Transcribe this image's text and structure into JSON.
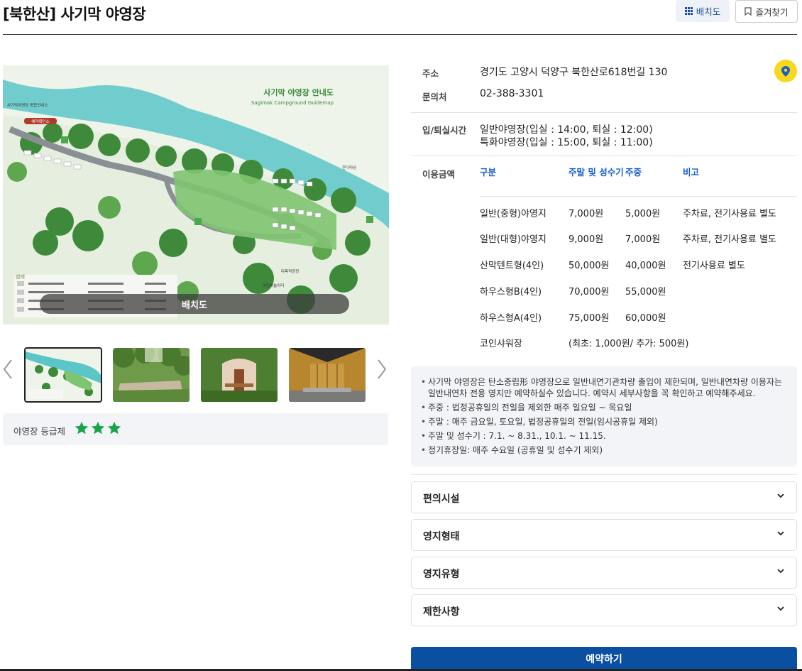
{
  "header": {
    "title": "[북한산] 사기막 야영장",
    "map_button": "배치도",
    "favorite_button": "즐겨찾기"
  },
  "gallery": {
    "map_title_ko": "사기막 야영장 안내도",
    "map_title_en": "Sagimak Campground Guidemap",
    "map_caption": "배치도",
    "map_labels": [
      "사기막야영장 종합안내소",
      "예약확인소",
      "잔디마당",
      "다목적광장",
      "어린이놀이터",
      "범례"
    ],
    "thumbnails": [
      {
        "name": "map",
        "selected": true
      },
      {
        "name": "gravel-site",
        "selected": false
      },
      {
        "name": "tent-cabin",
        "selected": false
      },
      {
        "name": "tent-interior",
        "selected": false
      }
    ]
  },
  "grade": {
    "label": "야영장 등급제",
    "stars": 3
  },
  "info": {
    "address_label": "주소",
    "address": "경기도 고양시 덕양구 북한산로618번길 130",
    "contact_label": "문의처",
    "contact": "02-388-3301",
    "time_label": "입/퇴실시간",
    "time_lines": [
      "일반야영장(입실 : 14:00, 퇴실 : 12:00)",
      "특화야영장(입실 : 15:00, 퇴실 : 11:00)"
    ],
    "fee_label": "이용금액",
    "fee_headers": [
      "구분",
      "주말 및 성수기",
      "주중",
      "비고"
    ],
    "fee_rows": [
      [
        "일반(중형)야영지",
        "7,000원",
        "5,000원",
        "주차료, 전기사용료 별도"
      ],
      [
        "일반(대형)야영지",
        "9,000원",
        "7,000원",
        "주차료, 전기사용료 별도"
      ],
      [
        "산막텐트형(4인)",
        "50,000원",
        "40,000원",
        "전기사용료 별도"
      ],
      [
        "하우스형B(4인)",
        "70,000원",
        "55,000원",
        ""
      ],
      [
        "하우스형A(4인)",
        "75,000원",
        "60,000원",
        ""
      ]
    ],
    "shower_label": "코인샤워장",
    "shower_value": "(최초: 1,000원/ 추가: 500원)"
  },
  "notice": [
    "사기막 야영장은 탄소중립形 야영장으로 일반내연기관차량 출입이 제한되며, 일반내연차량 이용자는 일반내연차 전용 영지만 예약하실수 있습니다. 예약시 세부사항을 꼭 확인하고 예약해주세요.",
    "주중 : 법정공휴일의 전일을 제외한 매주 일요일 ~ 목요일",
    "주말 : 매주 금요일, 토요일, 법정공휴일의 전일(임시공휴일 제외)",
    "주말 및 성수기 : 7.1. ~ 8.31., 10.1. ~ 11.15.",
    "정기휴장일: 매주 수요일 (공휴일 및 성수기 제외)"
  ],
  "accordions": [
    "편의시설",
    "영지형태",
    "영지유형",
    "제한사항"
  ],
  "reserve_button": "예약하기",
  "colors": {
    "accent": "#0b4fa3",
    "link": "#1a5fc8",
    "star": "#1aa34a",
    "pin": "#f7d81a"
  }
}
